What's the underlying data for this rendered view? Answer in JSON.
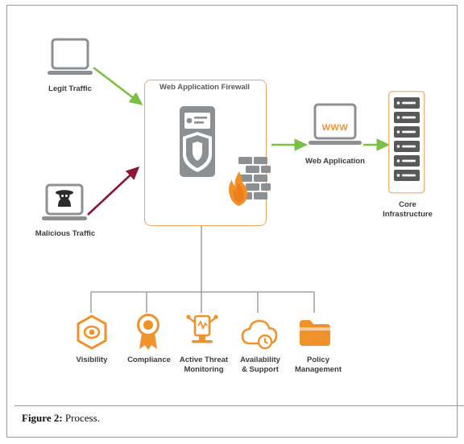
{
  "figure": {
    "caption_bold": "Figure 2:",
    "caption_text": " Process."
  },
  "diagram": {
    "title": "Web Application Firewall",
    "nodes": [
      {
        "id": "legit-traffic",
        "label": "Legit Traffic",
        "icon": "laptop-icon"
      },
      {
        "id": "malicious-traffic",
        "label": "Malicious Traffic",
        "icon": "hacker-laptop-icon"
      },
      {
        "id": "waf",
        "label": "Web Application Firewall",
        "icon": "shield-document-icon"
      },
      {
        "id": "web-application",
        "label": "Web Application",
        "icon": "laptop-www-icon",
        "screen_text": "WWW"
      },
      {
        "id": "core-infrastructure",
        "label": "Core\nInfrastructure",
        "label_line1": "Core",
        "label_line2": "Infrastructure",
        "icon": "server-rack-icon"
      }
    ],
    "arrows": [
      {
        "id": "arrow-legit",
        "from": "legit-traffic",
        "to": "waf",
        "color": "#7ac143"
      },
      {
        "id": "arrow-malicious",
        "from": "malicious-traffic",
        "to": "waf",
        "color": "#8e1537"
      },
      {
        "id": "arrow-waf-web",
        "from": "waf",
        "to": "web-application",
        "color": "#7ac143"
      },
      {
        "id": "arrow-web-core",
        "from": "web-application",
        "to": "core-infrastructure",
        "color": "#7ac143"
      }
    ],
    "features": [
      {
        "id": "visibility",
        "label_line1": "Visibility",
        "label_line2": "",
        "icon": "eye-hexagon-icon",
        "color": "#f0922c"
      },
      {
        "id": "compliance",
        "label_line1": "Compliance",
        "label_line2": "",
        "icon": "award-ribbon-icon",
        "color": "#f0922c"
      },
      {
        "id": "active-threat-monitoring",
        "label_line1": "Active Threat",
        "label_line2": "Monitoring",
        "icon": "monitoring-icon",
        "color": "#f0922c"
      },
      {
        "id": "availability-support",
        "label_line1": "Availability",
        "label_line2": "& Support",
        "icon": "cloud-clock-icon",
        "color": "#f0922c"
      },
      {
        "id": "policy-management",
        "label_line1": "Policy",
        "label_line2": "Management",
        "icon": "folder-icon",
        "color": "#f0922c"
      }
    ],
    "colors": {
      "accent_orange": "#f0922c",
      "green_arrow": "#7ac143",
      "red_arrow": "#8e1537",
      "grey_device": "#8d9093",
      "frame": "#9a9a9a"
    }
  }
}
